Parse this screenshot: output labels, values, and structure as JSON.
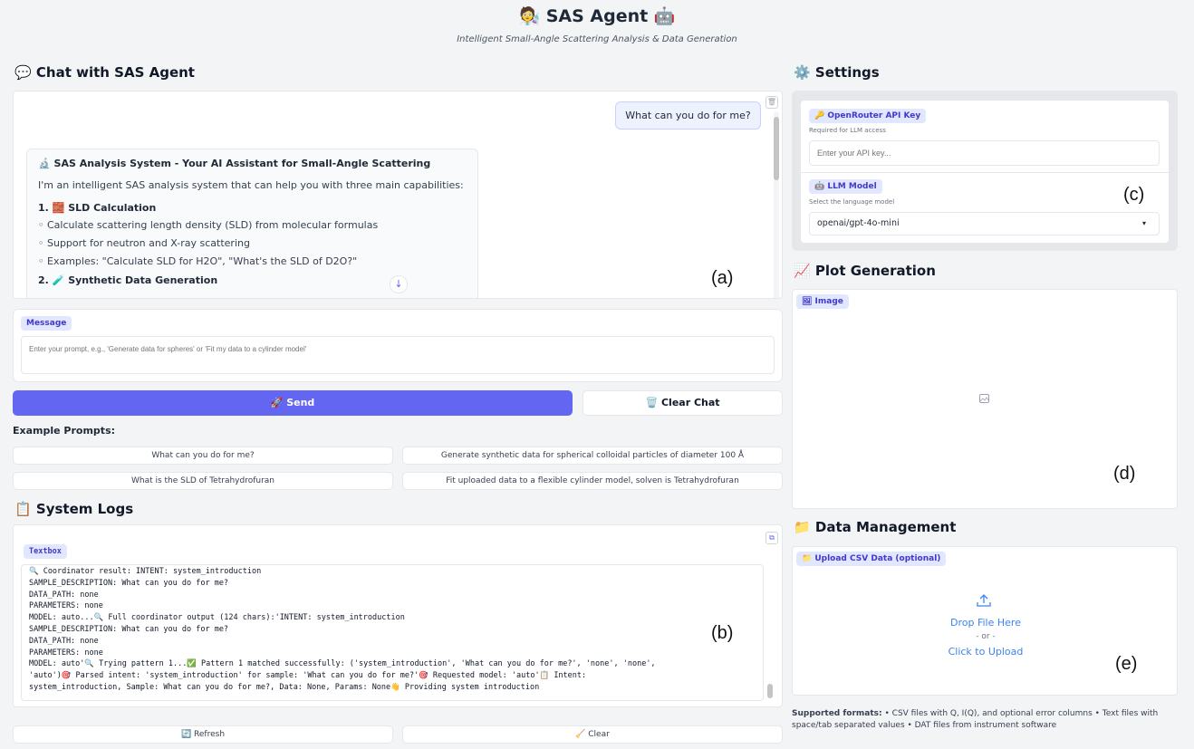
{
  "header": {
    "title": "🧑‍🔬 SAS Agent 🤖",
    "subtitle": "Intelligent Small-Angle Scattering Analysis & Data Generation"
  },
  "chat": {
    "section_title": "💬 Chat with SAS Agent",
    "user_message": "What can you do for me?",
    "bot": {
      "title": "🔬 SAS Analysis System - Your AI Assistant for Small-Angle Scattering",
      "intro": "I'm an intelligent SAS analysis system that can help you with three main capabilities:",
      "h1": "1. 🧱 SLD Calculation",
      "items": [
        "Calculate scattering length density (SLD) from molecular formulas",
        "Support for neutron and X-ray scattering",
        "Examples: \"Calculate SLD for H2O\", \"What's the SLD of D2O?\""
      ],
      "h2": "2. 🧪 Synthetic Data Generation"
    },
    "marker": "(a)",
    "message_label": "Message",
    "message_placeholder": "Enter your prompt, e.g., 'Generate data for spheres' or 'Fit my data to a cylinder model'",
    "send_label": "🚀 Send",
    "clear_chat_label": "🗑️ Clear Chat",
    "examples_title": "Example Prompts:",
    "examples": [
      "What can you do for me?",
      "Generate synthetic data for spherical colloidal particles of diameter 100 Å",
      "What is the SLD of Tetrahydrofuran",
      "Fit uploaded data to a flexible cylinder model, solven is Tetrahydrofuran"
    ]
  },
  "logs": {
    "section_title": "📋 System Logs",
    "textbox_label": "Textbox",
    "lines": [
      "🔍 Coordinator result: INTENT: system_introduction",
      "SAMPLE_DESCRIPTION: What can you do for me?",
      "DATA_PATH: none",
      "PARAMETERS: none",
      "MODEL: auto...🔍 Full coordinator output (124 chars):'INTENT: system_introduction",
      "SAMPLE_DESCRIPTION: What can you do for me?",
      "DATA_PATH: none",
      "PARAMETERS: none",
      "MODEL: auto'🔍 Trying pattern 1...✅ Pattern 1 matched successfully: ('system_introduction', 'What can you do for me?', 'none', 'none',",
      "'auto')🎯 Parsed intent: 'system_introduction' for sample: 'What can you do for me?'🎯 Requested model: 'auto'📋 Intent:",
      "system_introduction, Sample: What can you do for me?, Data: None, Params: None👋 Providing system introduction"
    ],
    "marker": "(b)",
    "refresh_label": "🔄 Refresh",
    "clear_label": "🧹 Clear"
  },
  "settings": {
    "section_title": "⚙️ Settings",
    "api_key_label": "🔑 OpenRouter API Key",
    "api_key_info": "Required for LLM access",
    "api_key_placeholder": "Enter your API key...",
    "model_label": "🤖 LLM Model",
    "model_info": "Select the language model",
    "model_value": "openai/gpt-4o-mini",
    "marker": "(c)"
  },
  "plot": {
    "section_title": "📈 Plot Generation",
    "image_label": "🖼 Image",
    "marker": "(d)"
  },
  "data_mgmt": {
    "section_title": "📁 Data Management",
    "upload_label": "📁 Upload CSV Data (optional)",
    "drop_text": "Drop File Here",
    "or_text": "- or -",
    "click_text": "Click to Upload",
    "marker": "(e)",
    "formats_bold": "Supported formats:",
    "formats_text": " • CSV files with Q, I(Q), and optional error columns • Text files with space/tab separated values • DAT files from instrument software"
  },
  "colors": {
    "accent": "#6366f1",
    "label_bg": "#e0e7ff",
    "label_fg": "#4338ca",
    "upload_blue": "#3b82f6"
  }
}
